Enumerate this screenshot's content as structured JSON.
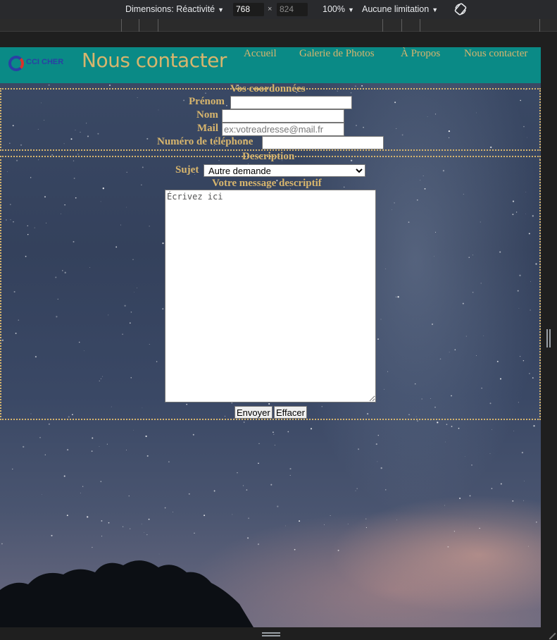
{
  "devtools": {
    "dimensions_label": "Dimensions: Réactivité",
    "width": "768",
    "height": "824",
    "times": "×",
    "zoom": "100%",
    "throttle": "Aucune limitation",
    "rotate_icon": "rotate-icon"
  },
  "site": {
    "logo_text": "CCI CHER",
    "page_title": "Nous contacter",
    "nav": [
      "Accueil",
      "Galerie de Photos",
      "À Propos",
      "Nous contacter"
    ],
    "accent_color": "#d7b56d",
    "navbar_color": "#0a8a86"
  },
  "form": {
    "coords_legend": "Vos coordonnées",
    "prenom_label": "Prénom",
    "nom_label": "Nom",
    "mail_label": "Mail",
    "mail_placeholder": "ex:votreadresse@mail.fr",
    "phone_label": "Numéro de téléphone",
    "description_legend": "Description",
    "subject_label": "Sujet",
    "subject_value": "Autre demande",
    "message_label": "Votre message descriptif",
    "message_placeholder": "Écrivez ici",
    "submit_label": "Envoyer",
    "reset_label": "Effacer"
  }
}
